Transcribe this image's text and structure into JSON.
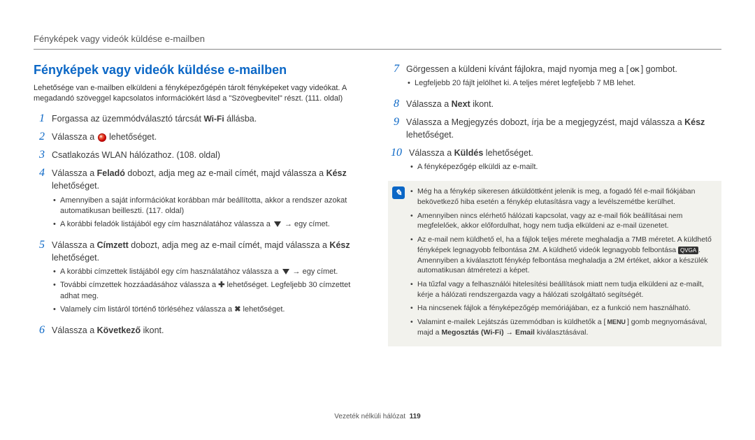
{
  "header": "Fényképek vagy videók küldése e-mailben",
  "title": "Fényképek vagy videók küldése e-mailben",
  "intro": "Lehetősége van e-mailben elküldeni a fényképezőgépén tárolt fényképeket vagy videókat. A megadandó szöveggel kapcsolatos információkért lásd a \"Szövegbevitel\" részt. (111. oldal)",
  "steps": {
    "s1a": "Forgassa az üzemmódválasztó tárcsát ",
    "s1b": " állásba.",
    "wifi": "Wi-Fi",
    "s2a": "Válassza a ",
    "s2b": " lehetőséget.",
    "s3": "Csatlakozás WLAN hálózathoz. (108. oldal)",
    "s4a": "Válassza a ",
    "s4b": "Feladó",
    "s4c": " dobozt, adja meg az e-mail címét, majd válassza a ",
    "s4d": "Kész",
    "s4e": " lehetőséget.",
    "s4_sub1": "Amennyiben a saját információkat korábban már beállította, akkor a rendszer azokat automatikusan beilleszti. (117. oldal)",
    "s4_sub2a": "A korábbi feladók listájából egy cím használatához válassza a ",
    "s4_sub2b": " → egy címet.",
    "s5a": "Válassza a ",
    "s5b": "Címzett",
    "s5c": " dobozt, adja meg az e-mail címét, majd válassza a ",
    "s5d": "Kész",
    "s5e": " lehetőséget.",
    "s5_sub1a": "A korábbi címzettek listájából egy cím használatához válassza a ",
    "s5_sub1b": " → egy címet.",
    "s5_sub2a": "További címzettek hozzáadásához válassza a ",
    "s5_sub2b": " lehetőséget. Legfeljebb 30 címzettet adhat meg.",
    "s5_sub3a": "Valamely cím listáról történő törléséhez válassza a ",
    "s5_sub3b": " lehetőséget.",
    "s6a": "Válassza a ",
    "s6b": "Következő",
    "s6c": " ikont.",
    "s7a": "Görgessen a küldeni kívánt fájlokra, majd nyomja meg a [",
    "s7b": "] gombot.",
    "ok": "OK",
    "s7_sub1": "Legfeljebb 20 fájlt jelölhet ki. A teljes méret legfeljebb 7 MB lehet.",
    "s8a": "Válassza a ",
    "s8b": "Next",
    "s8c": " ikont.",
    "s9a": "Válassza a Megjegyzés dobozt, írja be a megjegyzést, majd válassza a ",
    "s9b": "Kész",
    "s9c": " lehetőséget.",
    "s10a": "Válassza a ",
    "s10b": "Küldés",
    "s10c": " lehetőséget.",
    "s10_sub1": "A fényképezőgép elküldi az e-mailt."
  },
  "notes": {
    "n1": "Még ha a fénykép sikeresen átküldöttként jelenik is meg, a fogadó fél e-mail fiókjában bekövetkező hiba esetén a fénykép elutasításra vagy a levélszemétbe kerülhet.",
    "n2": "Amennyiben nincs elérhető hálózati kapcsolat, vagy az e-mail fiók beállításai nem megfelelőek, akkor előfordulhat, hogy nem tudja elküldeni az e-mail üzenetet.",
    "n3a": "Az e-mail nem küldhető el, ha a fájlok teljes mérete meghaladja a 7MB méretet. A küldhető fényképek legnagyobb felbontása 2M. A küldhető videók legnagyobb felbontása ",
    "n3b": ". Amennyiben a kiválasztott fénykép felbontása meghaladja a 2M értéket, akkor a készülék automatikusan átméretezi a képet.",
    "n4": "Ha tűzfal vagy a felhasználói hitelesítési beállítások miatt nem tudja elküldeni az e-mailt, kérje a hálózati rendszergazda vagy a hálózati szolgáltató segítségét.",
    "n5": "Ha nincsenek fájlok a fényképezőgép memóriájában, ez a funkció nem használható.",
    "n6a": "Valamint e-mailek Lejátszás üzemmódban is küldhetők a [",
    "n6b": "] gomb megnyomásával, majd a ",
    "n6c": "Megosztás (Wi-Fi)",
    "n6d": " → ",
    "n6e": "Email",
    "n6f": " kiválasztásával.",
    "menu": "MENU",
    "hd": "QVGA"
  },
  "footer_label": "Vezeték nélküli hálózat",
  "footer_page": "119"
}
